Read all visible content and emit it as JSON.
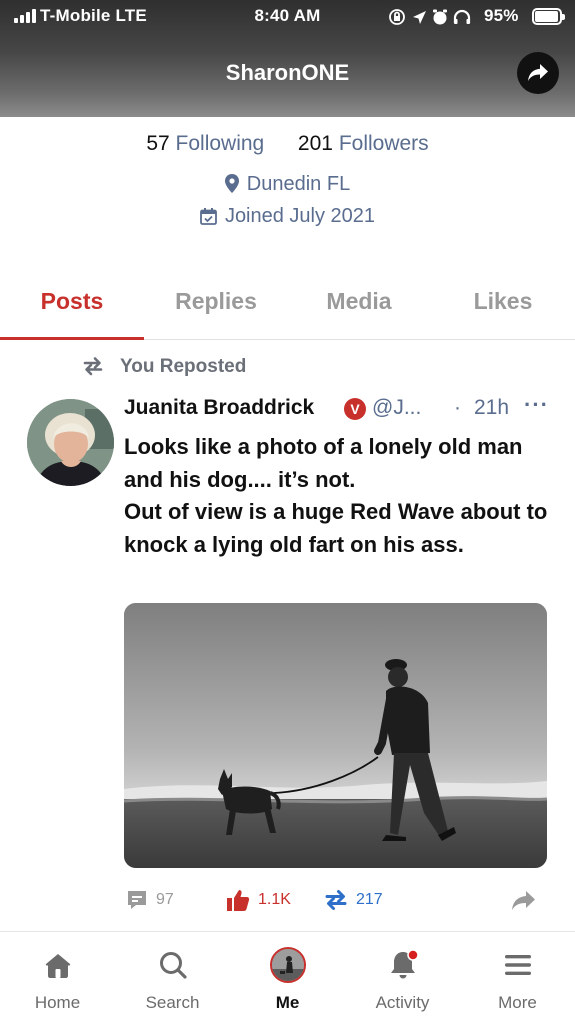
{
  "status_bar": {
    "carrier": "T-Mobile  LTE",
    "time": "8:40 AM",
    "battery": "95%",
    "battery_level": 0.95
  },
  "header": {
    "title": "SharonONE",
    "share_icon": "share-arrow-icon"
  },
  "profile": {
    "following_count": "57",
    "following_label": "Following",
    "followers_count": "201",
    "followers_label": "Followers",
    "location": "Dunedin FL",
    "joined": "Joined July 2021"
  },
  "tabs": [
    {
      "label": "Posts",
      "active": true
    },
    {
      "label": "Replies",
      "active": false
    },
    {
      "label": "Media",
      "active": false
    },
    {
      "label": "Likes",
      "active": false
    }
  ],
  "post": {
    "repost_label": "You Reposted",
    "author": "Juanita Broaddrick",
    "verified_badge": "V",
    "handle": "@J...",
    "separator": "·",
    "time": "21h",
    "more": "···",
    "body_lines": [
      "Looks like a photo of a lonely old man and his dog.... it’s not.",
      "Out of view is a huge Red Wave about to knock a lying old fart on his ass."
    ],
    "comments": "97",
    "likes": "1.1K",
    "reposts": "217"
  },
  "bottom_nav": [
    {
      "label": "Home",
      "icon": "home-icon",
      "active": false
    },
    {
      "label": "Search",
      "icon": "search-icon",
      "active": false
    },
    {
      "label": "Me",
      "icon": "profile-avatar-icon",
      "active": true
    },
    {
      "label": "Activity",
      "icon": "bell-icon",
      "active": false,
      "badge": true
    },
    {
      "label": "More",
      "icon": "menu-icon",
      "active": false
    }
  ],
  "colors": {
    "accent_red": "#c8302c",
    "link_blue": "#2d6fc9",
    "muted_slate": "#5a6d8f"
  }
}
